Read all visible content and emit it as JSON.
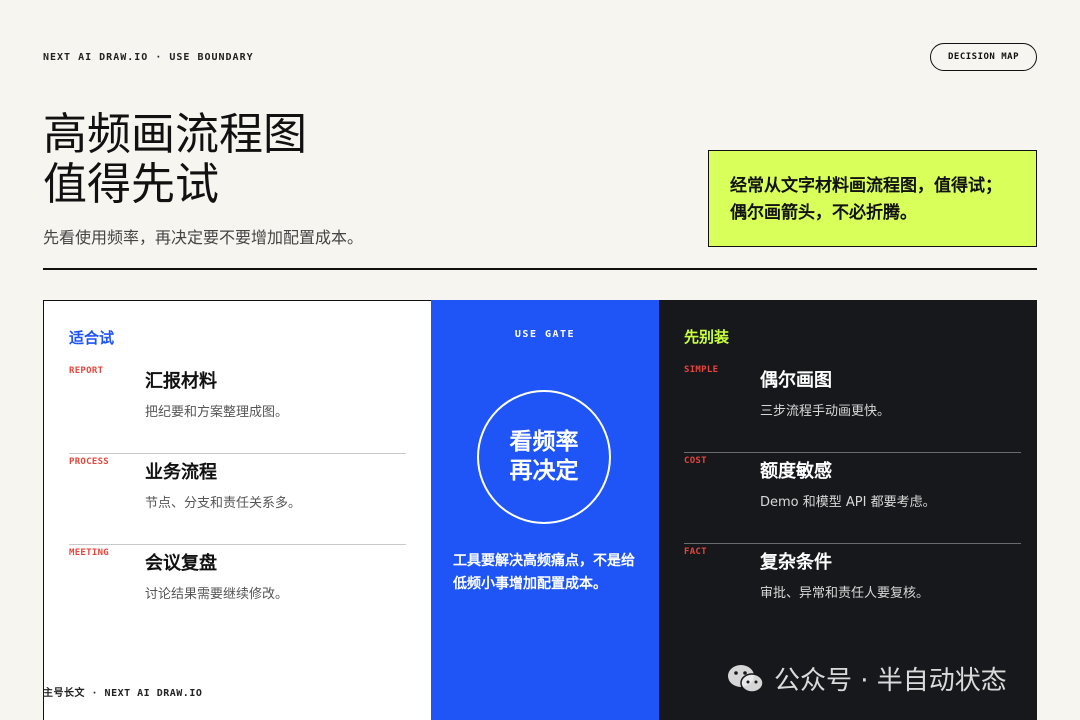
{
  "header": {
    "eyebrow": "NEXT AI DRAW.IO · USE BOUNDARY",
    "pill": "DECISION MAP"
  },
  "hero": {
    "title_line1": "高频画流程图",
    "title_line2": "值得先试",
    "subtitle": "先看使用频率，再决定要不要增加配置成本。"
  },
  "callout": {
    "text": "经常从文字材料画流程图，值得试；偶尔画箭头，不必折腾。"
  },
  "left_panel": {
    "heading": "适合试",
    "items": [
      {
        "tag": "REPORT",
        "title": "汇报材料",
        "desc": "把纪要和方案整理成图。"
      },
      {
        "tag": "PROCESS",
        "title": "业务流程",
        "desc": "节点、分支和责任关系多。"
      },
      {
        "tag": "MEETING",
        "title": "会议复盘",
        "desc": "讨论结果需要继续修改。"
      }
    ]
  },
  "mid_panel": {
    "label": "USE GATE",
    "circle_line1": "看频率",
    "circle_line2": "再决定",
    "note": "工具要解决高频痛点，不是给低频小事增加配置成本。"
  },
  "right_panel": {
    "heading": "先别装",
    "items": [
      {
        "tag": "SIMPLE",
        "title": "偶尔画图",
        "desc": "三步流程手动画更快。"
      },
      {
        "tag": "COST",
        "title": "额度敏感",
        "desc": "Demo 和模型 API 都要考虑。"
      },
      {
        "tag": "FACT",
        "title": "复杂条件",
        "desc": "审批、异常和责任人要复核。"
      }
    ]
  },
  "footer": {
    "left": "主号长文 · NEXT AI DRAW.IO",
    "watermark": "公众号 · 半自动状态"
  },
  "colors": {
    "background": "#f6f5f0",
    "accent_blue": "#1f55f6",
    "accent_lime": "#d9ff5a",
    "dark_panel": "#17181c",
    "tag_red": "#e8453c"
  },
  "icons": {
    "watermark_logo": "wechat-icon"
  }
}
